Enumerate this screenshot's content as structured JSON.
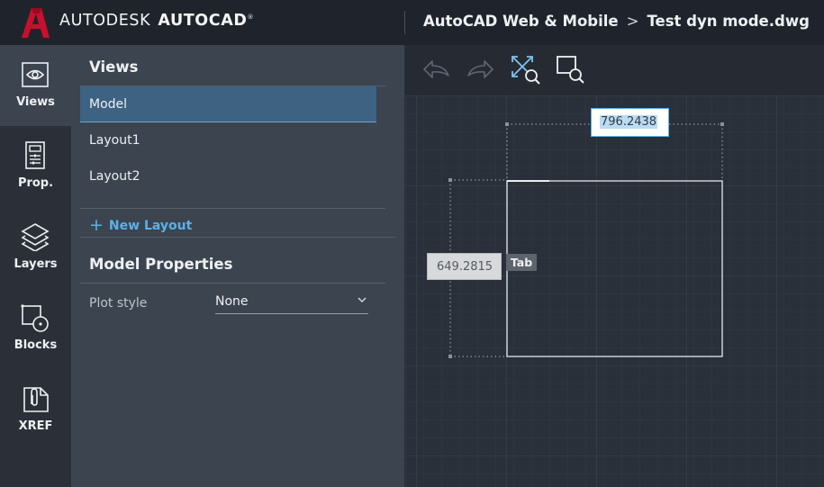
{
  "header": {
    "brand_left": "AUTODESK",
    "brand_right": "AUTOCAD",
    "brand_reg": "®",
    "breadcrumb_root": "AutoCAD Web & Mobile",
    "breadcrumb_sep": ">",
    "file_name": "Test dyn mode.dwg"
  },
  "rail": {
    "items": [
      {
        "label": "Views",
        "icon": "eye-icon",
        "active": true
      },
      {
        "label": "Prop.",
        "icon": "properties-icon",
        "active": false
      },
      {
        "label": "Layers",
        "icon": "layers-icon",
        "active": false
      },
      {
        "label": "Blocks",
        "icon": "blocks-icon",
        "active": false
      },
      {
        "label": "XREF",
        "icon": "xref-icon",
        "active": false
      }
    ]
  },
  "views_panel": {
    "title": "Views",
    "items": [
      "Model",
      "Layout1",
      "Layout2"
    ],
    "selected": "Model",
    "new_layout_plus": "+",
    "new_layout_label": "New Layout"
  },
  "model_properties": {
    "title": "Model Properties",
    "plot_style_label": "Plot style",
    "plot_style_value": "None"
  },
  "toolbar": {
    "icons": [
      "undo-icon",
      "redo-icon",
      "zoom-extents-icon",
      "zoom-window-icon"
    ]
  },
  "dynamic_input": {
    "width_value": "796.2438",
    "height_value": "649.2815",
    "tab_hint": "Tab"
  },
  "colors": {
    "accent": "#5ab2e8",
    "selected_row": "#3d6282",
    "logo_red": "#c8102e",
    "grid_minor": "#333a45",
    "grid_major": "#3d4551"
  }
}
